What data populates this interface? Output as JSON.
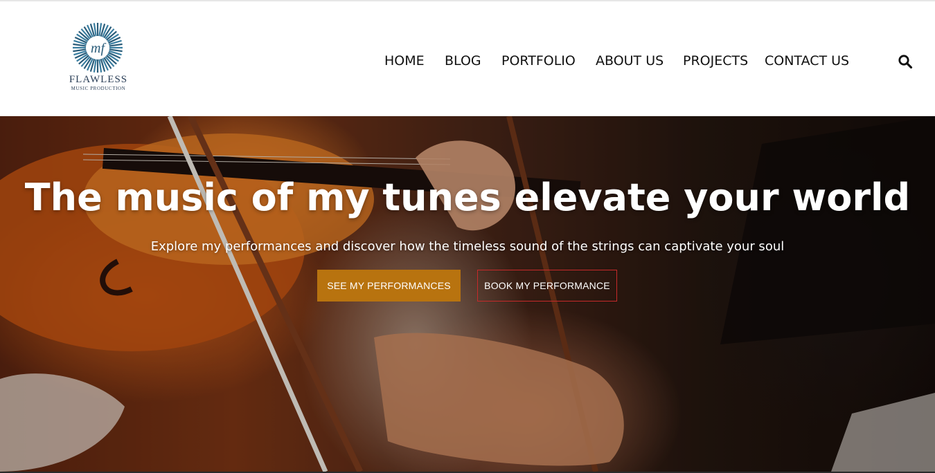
{
  "brand": {
    "logo_monogram": "mf",
    "name": "FLAWLESS",
    "tagline": "MUSIC PRODUCTION",
    "color": "#2b3f57"
  },
  "nav": {
    "items": [
      {
        "label": "HOME"
      },
      {
        "label": "BLOG"
      },
      {
        "label": "PORTFOLIO"
      },
      {
        "label": "ABOUT US"
      },
      {
        "label": "PROJECTS"
      },
      {
        "label": "CONTACT US"
      }
    ],
    "search_icon": "search-icon"
  },
  "hero": {
    "title": "The music of my tunes elevate your world",
    "subtitle": "Explore my performances and discover how the timeless sound of the strings can captivate your soul",
    "primary_button": "SEE MY PERFORMANCES",
    "secondary_button": "BOOK MY PERFORMANCE",
    "primary_color": "#b8730f",
    "secondary_border_color": "#c62a2a"
  }
}
